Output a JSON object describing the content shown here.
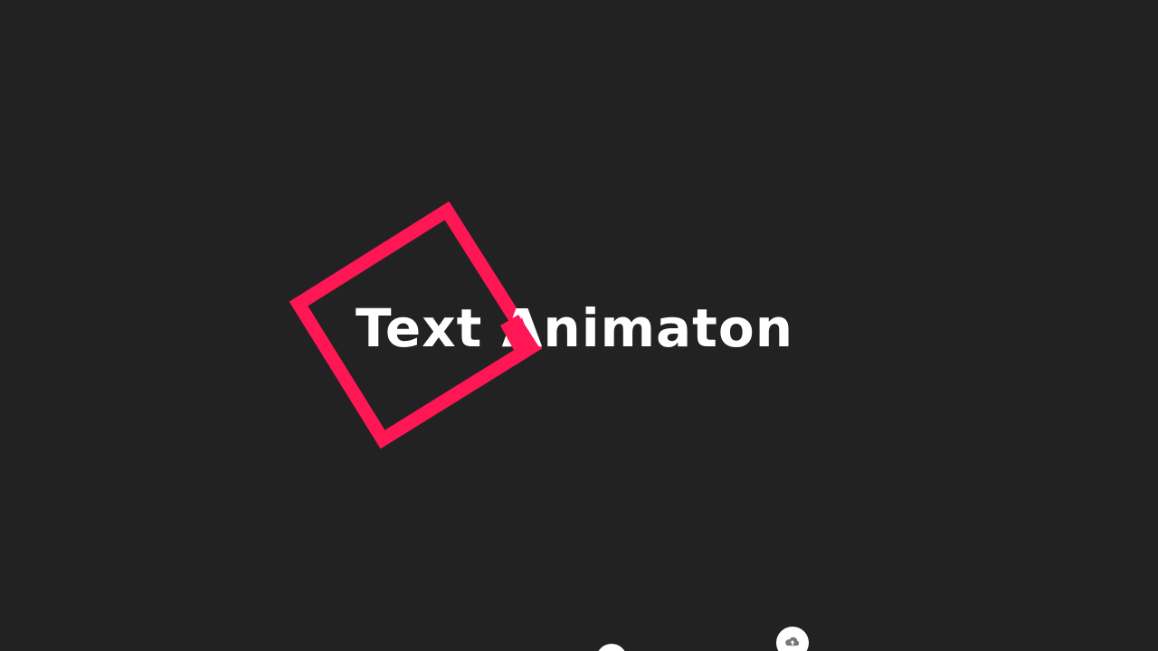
{
  "scene": {
    "headline": "Text Animaton",
    "accent_color": "#ff1654",
    "background_color": "#222222",
    "text_color": "#ffffff"
  },
  "icons": {
    "bottom_right": "cloud-upload-icon"
  }
}
